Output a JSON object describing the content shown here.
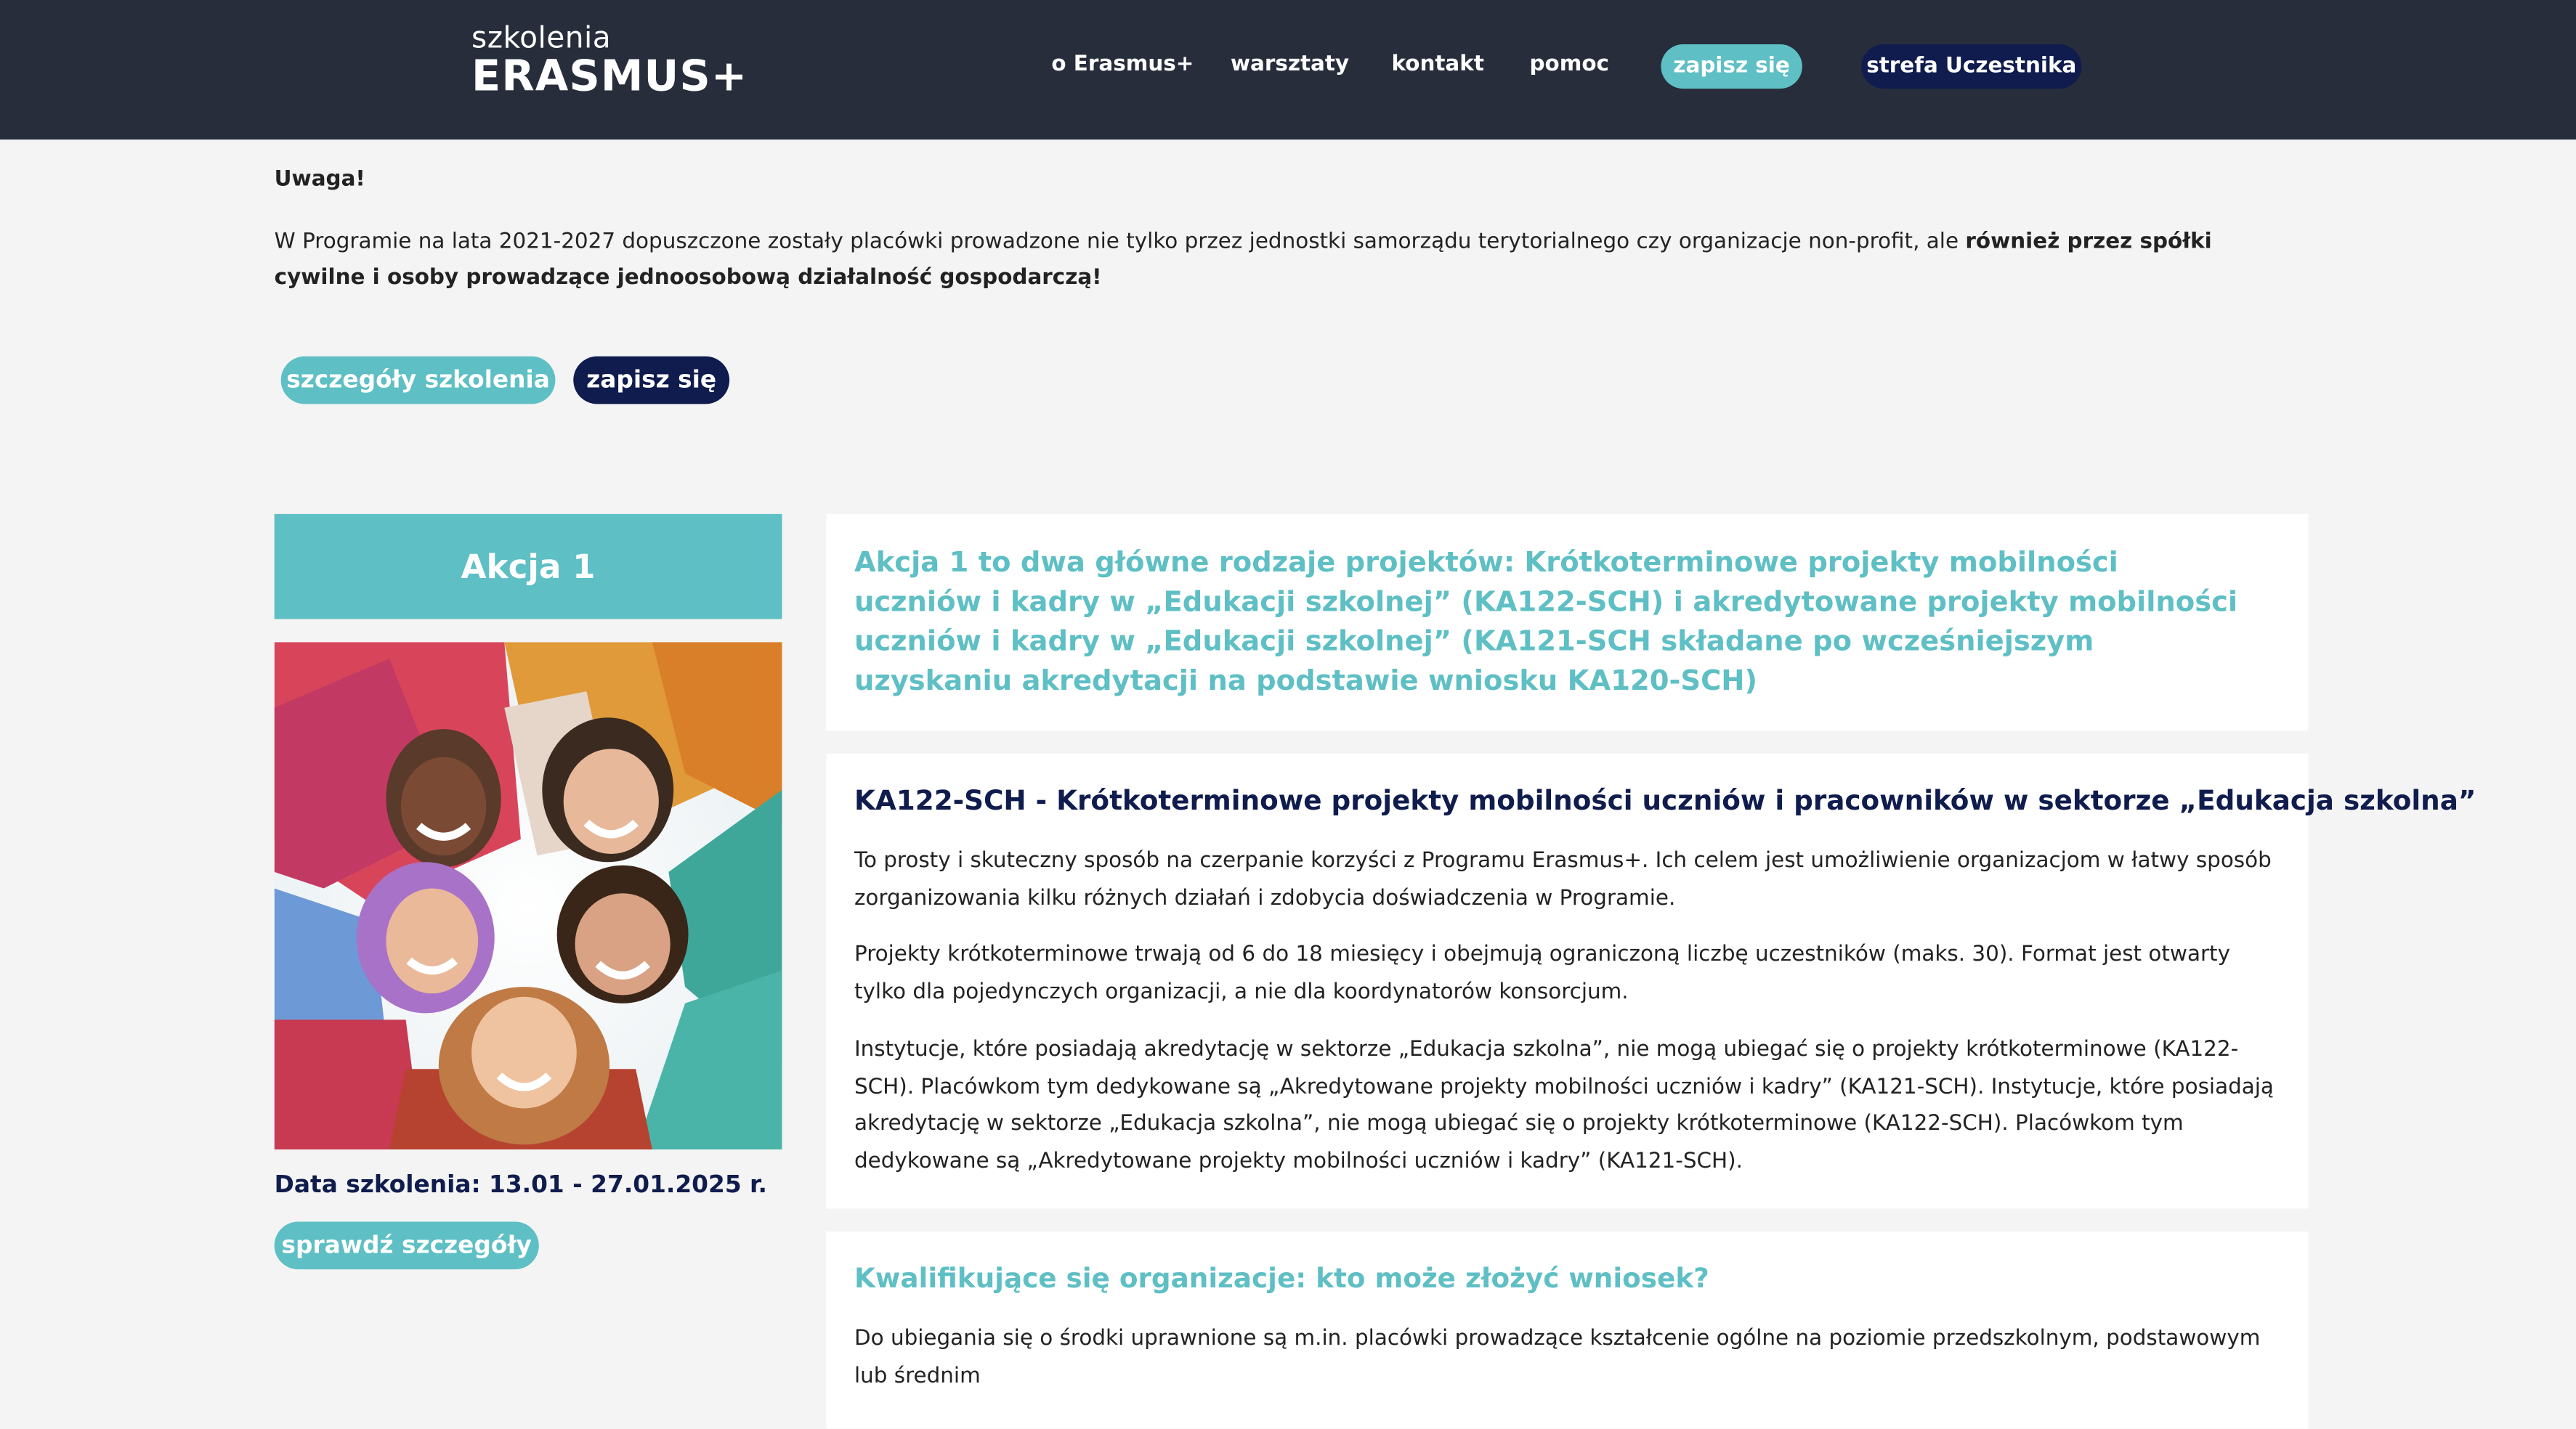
{
  "header": {
    "logo_small": "szkolenia",
    "logo_big": "ERASMUS+",
    "nav": [
      {
        "label": "o Erasmus+"
      },
      {
        "label": "warsztaty"
      },
      {
        "label": "kontakt"
      },
      {
        "label": "pomoc"
      }
    ],
    "signup_label": "zapisz się",
    "participant_zone_label": "strefa Uczestnika"
  },
  "notice": {
    "title": "Uwaga!",
    "text_regular": "W Programie na lata 2021-2027 dopuszczone zostały placówki prowadzone nie tylko przez jednostki samorządu terytorialnego czy organizacje non-profit, ale ",
    "text_bold": "również przez spółki cywilne i osoby prowadzące jednoosobową działalność gospodarczą!"
  },
  "buttons": {
    "details": "szczegóły szkolenia",
    "signup": "zapisz się"
  },
  "sidebar": {
    "title": "Akcja 1",
    "date": "Data szkolenia: 13.01 - 27.01.2025 r.",
    "check_details": "sprawdź szczegóły"
  },
  "main": {
    "intro": "Akcja 1 to dwa główne rodzaje projektów: Krótkoterminowe projekty mobilności uczniów i kadry w „Edukacji szkolnej” (KA122-SCH) i akredytowane projekty mobilności uczniów i kadry w „Edukacji szkolnej” (KA121-SCH składane po wcześniejszym uzyskaniu akredytacji na podstawie wniosku KA120-SCH)",
    "ka122_heading": "KA122-SCH - Krótkoterminowe projekty mobilności uczniów i pracowników w sektorze „Edukacja szkolna”",
    "ka122_p1": "To prosty i skuteczny sposób na czerpanie korzyści z Programu Erasmus+. Ich celem jest umożliwienie organizacjom w łatwy sposób zorganizowania kilku różnych działań i zdobycia doświadczenia w Programie.",
    "ka122_p2": "Projekty krótkoterminowe trwają od 6 do 18 miesięcy i obejmują ograniczoną liczbę uczestników (maks. 30). Format jest otwarty tylko dla pojedynczych organizacji, a nie dla koordynatorów konsorcjum.",
    "ka122_p3": "Instytucje, które posiadają akredytację w sektorze „Edukacja szkolna”, nie mogą ubiegać się o projekty krótkoterminowe (KA122-SCH). Placówkom tym dedykowane są „Akredytowane projekty mobilności uczniów i kadry” (KA121-SCH). Instytucje, które posiadają akredytację w sektorze „Edukacja szkolna”, nie mogą ubiegać się o projekty krótkoterminowe (KA122-SCH). Placówkom tym dedykowane są „Akredytowane projekty mobilności uczniów i kadry” (KA121-SCH).",
    "kwal_heading": "Kwalifikujące się organizacje: kto może złożyć wniosek?",
    "kwal_p1": "Do ubiegania się o środki uprawnione są m.in. placówki prowadzące kształcenie ogólne na poziomie przedszkolnym, podstawowym lub średnim"
  },
  "colors": {
    "header_bg": "#272d3b",
    "teal": "#5ebfc4",
    "navy": "#0f1c4d",
    "page_bg": "#f4f4f4"
  }
}
